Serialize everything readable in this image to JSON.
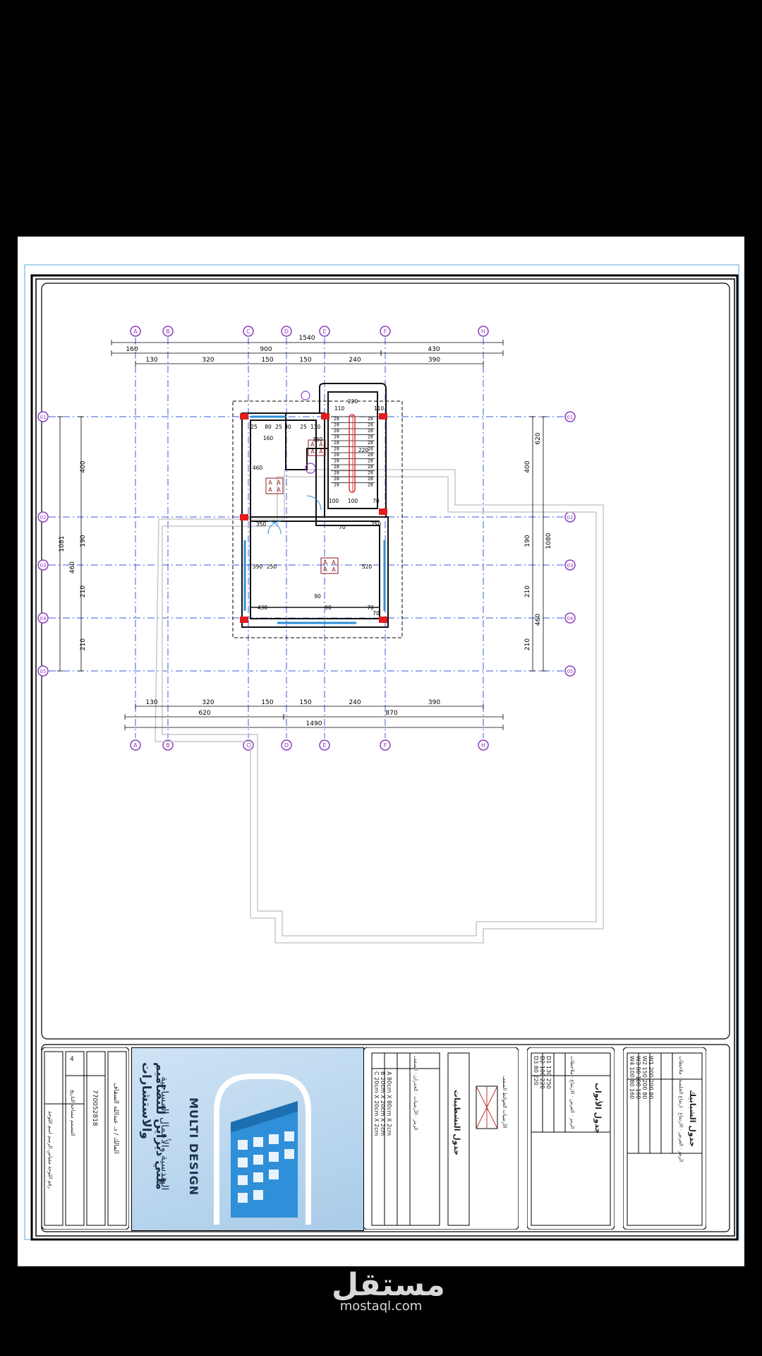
{
  "plan": {
    "grid_top": [
      "A",
      "B",
      "C",
      "D",
      "E",
      "F",
      "H"
    ],
    "grid_side": [
      "01",
      "02",
      "03",
      "04",
      "05"
    ],
    "dims_top_total": "1540",
    "dims_top_mid": [
      "160",
      "900",
      "430"
    ],
    "dims_top_row": [
      "130",
      "320",
      "150",
      "150",
      "240",
      "390"
    ],
    "dims_bottom_row": [
      "130",
      "320",
      "150",
      "150",
      "240",
      "390"
    ],
    "dims_bottom_mid": [
      "620",
      "870"
    ],
    "dims_bottom_total": "1490",
    "dims_left": [
      "400",
      "190",
      "210",
      "210"
    ],
    "dims_left_inner": [
      "1081",
      "460"
    ],
    "dims_right": [
      "400",
      "190",
      "210",
      "210"
    ],
    "dims_right_outer": [
      "620",
      "1080",
      "460"
    ],
    "room_dims": [
      "220",
      "110",
      "110",
      "25",
      "80",
      "25",
      "80",
      "25",
      "130",
      "160",
      "380",
      "460",
      "220",
      "100",
      "100",
      "70",
      "350",
      "70",
      "250",
      "390",
      "250",
      "520",
      "90",
      "430",
      "90",
      "70",
      "70"
    ],
    "stair_label": "28"
  },
  "tables": {
    "windows_title": "جدول الشبابيك",
    "windows_header": [
      "الرمز",
      "العرض",
      "الارتفاع",
      "ارتفاع الجلسة",
      "ملاحظات"
    ],
    "windows_rows": [
      [
        "W1",
        "200",
        "200",
        "80"
      ],
      [
        "W2",
        "150",
        "200",
        "80"
      ],
      [
        "W3",
        "80",
        "100",
        "160"
      ],
      [
        "W4",
        "100",
        "80",
        "160"
      ]
    ],
    "doors_title": "جدول الأبواب",
    "doors_header": [
      "الرمز",
      "العرض",
      "الارتفاع",
      "ملاحظات"
    ],
    "doors_rows": [
      [
        "D1",
        "130",
        "250"
      ],
      [
        "D2",
        "100",
        "220"
      ],
      [
        "D3",
        "80",
        "220"
      ]
    ],
    "finishes_title": "جدول التشطيبات",
    "finishes_header": [
      "الرمز",
      "الأرضيات",
      "الجدران",
      "السقف"
    ],
    "finishes_rows": [
      [
        "A",
        "80cm X 80cm X 2cm"
      ],
      [
        "B",
        "20cm X 20cm X 2cm"
      ],
      [
        "C",
        "20cm X 20cm X 2cm"
      ]
    ],
    "legend_labels": [
      "الأرضيات",
      "الحوائط",
      "السقف"
    ]
  },
  "title_block": {
    "logo_line1": "ملتي ديزاين للتصاميم والاستشارات",
    "logo_line2": "الهندسية والأعمال المساحية",
    "logo_latin": "MULTI DESIGN",
    "owner_label": "المالك / د. عبدالله السقاف",
    "owner_phone": "770052818",
    "sheet_number": "4",
    "labels": [
      "رقم اللوحة",
      "مقياس الرسم",
      "اسم اللوحة",
      "المصمم",
      "مساحة",
      "التاريخ"
    ]
  },
  "watermark": {
    "arabic": "مستقل",
    "latin": "mostaql.com"
  },
  "colors": {
    "grid_circle": "#8e3fbf",
    "grid_line": "#3b5bdb",
    "wall": "#111111",
    "column": "#e11d1d",
    "window": "#2b8fd8",
    "logo_blue": "#2f8fd8"
  }
}
